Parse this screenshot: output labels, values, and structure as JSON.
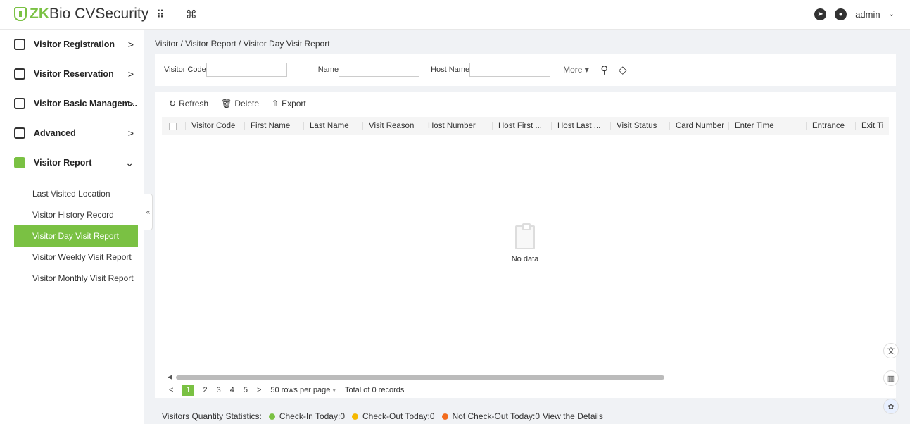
{
  "header": {
    "logo_brand": "ZKBio CVSecurity",
    "logo_z": "Z",
    "logo_k": "K",
    "logo_bio": "Bio CVSecurity",
    "grid_icon": "grid-icon",
    "cmd_icon": "command-icon",
    "user": "admin"
  },
  "sidebar": {
    "items": [
      {
        "label": "Visitor Registration",
        "arrow": ">"
      },
      {
        "label": "Visitor Reservation",
        "arrow": ">"
      },
      {
        "label": "Visitor Basic Managem...",
        "arrow": ">"
      },
      {
        "label": "Advanced",
        "arrow": ">"
      },
      {
        "label": "Visitor Report",
        "arrow": "⌄"
      }
    ],
    "sub_items": [
      {
        "label": "Last Visited Location"
      },
      {
        "label": "Visitor History Record"
      },
      {
        "label": "Visitor Day Visit Report"
      },
      {
        "label": "Visitor Weekly Visit Report"
      },
      {
        "label": "Visitor Monthly Visit Report"
      }
    ],
    "collapse": "«"
  },
  "breadcrumb": "Visitor / Visitor Report / Visitor Day Visit Report",
  "search": {
    "visitor_code_label": "Visitor Code",
    "visitor_code_value": "",
    "name_label": "Name",
    "name_value": "",
    "host_name_label": "Host Name",
    "host_name_value": "",
    "more": "More ▾"
  },
  "toolbar": {
    "refresh": "Refresh",
    "delete": "Delete",
    "export": "Export"
  },
  "table": {
    "columns": [
      "Visitor Code",
      "First Name",
      "Last Name",
      "Visit Reason",
      "Host Number",
      "Host First ...",
      "Host Last ...",
      "Visit Status",
      "Card Number",
      "Enter Time",
      "Entrance",
      "Exit Ti"
    ],
    "empty_text": "No data"
  },
  "pagination": {
    "prev": "<",
    "pages": [
      "1",
      "2",
      "3",
      "4",
      "5"
    ],
    "next": ">",
    "rows_per_page": "50 rows per page",
    "total": "Total of 0 records"
  },
  "footer": {
    "label": "Visitors Quantity Statistics:",
    "checkin": "Check-In Today:0",
    "checkout": "Check-Out Today:0",
    "not_checkout": "Not Check-Out Today:0",
    "details_link": "View the Details",
    "colors": {
      "checkin": "#7ac143",
      "checkout": "#f5b800",
      "not_checkout": "#f26b1d"
    }
  },
  "accent_color": "#7ac143"
}
